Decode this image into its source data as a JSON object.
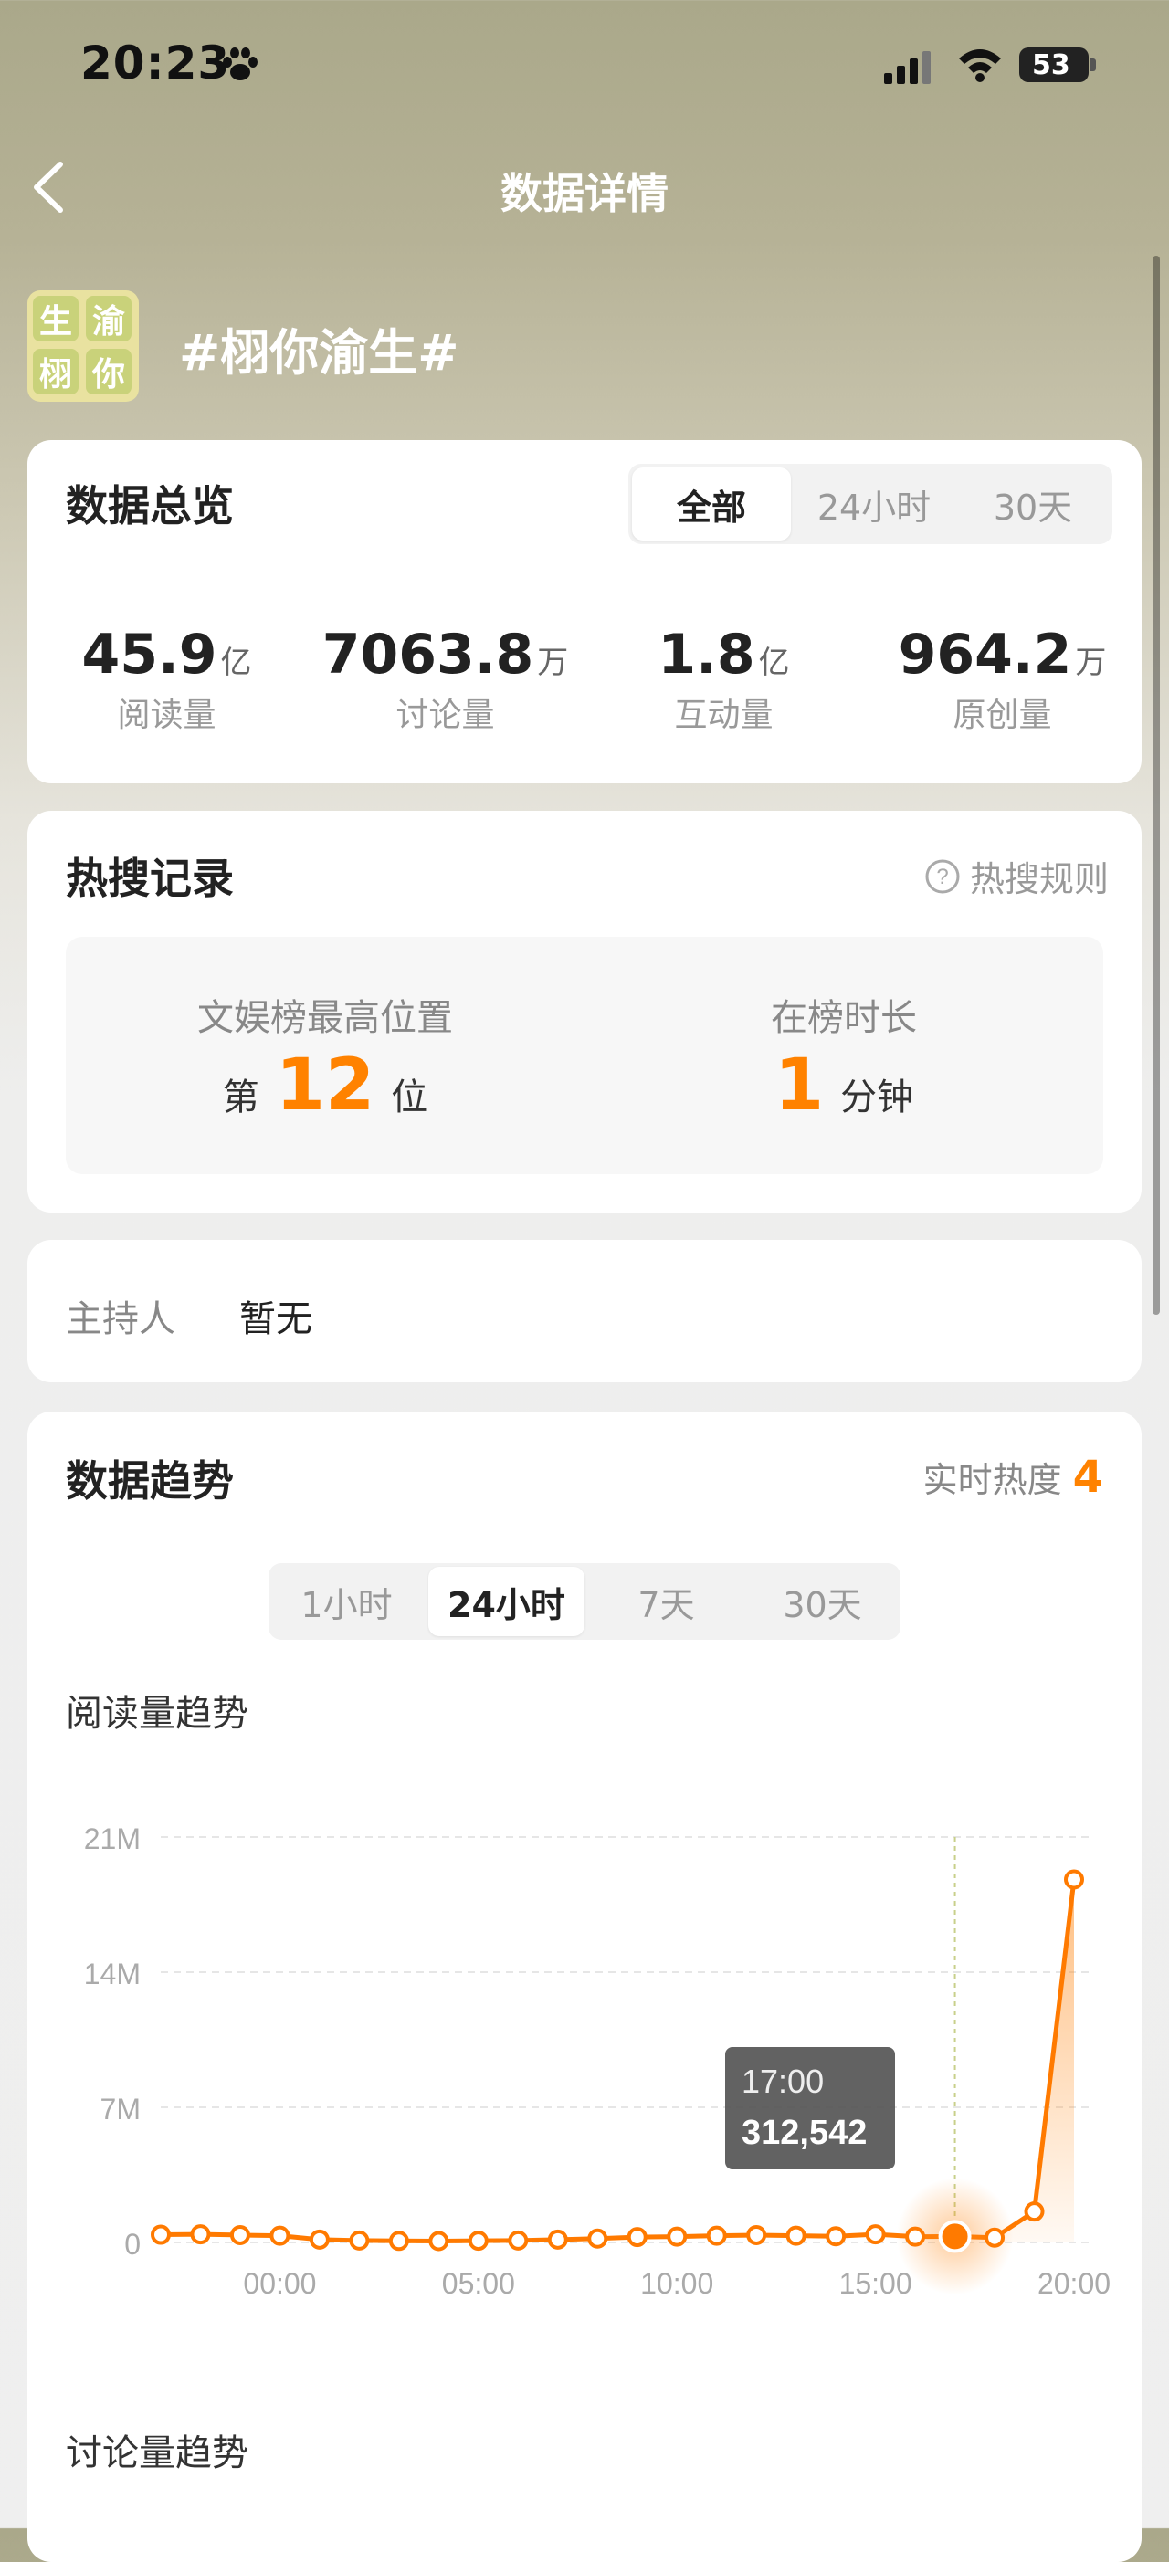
{
  "status_bar": {
    "time": "20:23",
    "battery": "53"
  },
  "nav": {
    "title": "数据详情"
  },
  "topic": {
    "name": "#栩你渝生#",
    "avatar_chars": [
      "生",
      "渝",
      "栩",
      "你"
    ]
  },
  "overview": {
    "title": "数据总览",
    "tabs": [
      {
        "label": "全部",
        "active": true
      },
      {
        "label": "24小时",
        "active": false
      },
      {
        "label": "30天",
        "active": false
      }
    ],
    "stats": [
      {
        "value": "45.9",
        "unit": "亿",
        "label": "阅读量"
      },
      {
        "value": "7063.8",
        "unit": "万",
        "label": "讨论量"
      },
      {
        "value": "1.8",
        "unit": "亿",
        "label": "互动量"
      },
      {
        "value": "964.2",
        "unit": "万",
        "label": "原创量"
      }
    ]
  },
  "hot_search": {
    "title": "热搜记录",
    "rule_label": "热搜规则",
    "best_rank": {
      "label": "文娱榜最高位置",
      "prefix": "第",
      "value": "12",
      "suffix": "位"
    },
    "duration": {
      "label": "在榜时长",
      "value": "1",
      "suffix": "分钟"
    }
  },
  "host": {
    "label": "主持人",
    "value": "暂无"
  },
  "trend": {
    "title": "数据趋势",
    "heat_label": "实时热度",
    "heat_value": "4",
    "tabs": [
      {
        "label": "1小时",
        "active": false
      },
      {
        "label": "24小时",
        "active": true
      },
      {
        "label": "7天",
        "active": false
      },
      {
        "label": "30天",
        "active": false
      }
    ],
    "read_title": "阅读量趋势",
    "discuss_title": "讨论量趋势",
    "tooltip": {
      "time": "17:00",
      "value": "312,542"
    }
  },
  "chart_data": {
    "type": "line",
    "title": "阅读量趋势",
    "xlabel": "",
    "ylabel": "",
    "x_ticks": [
      "00:00",
      "05:00",
      "10:00",
      "15:00",
      "20:00"
    ],
    "y_ticks": [
      "21M",
      "14M",
      "7M",
      "0"
    ],
    "ylim": [
      0,
      21000000
    ],
    "x": [
      "21:00",
      "22:00",
      "23:00",
      "00:00",
      "01:00",
      "02:00",
      "03:00",
      "04:00",
      "05:00",
      "06:00",
      "07:00",
      "08:00",
      "09:00",
      "10:00",
      "11:00",
      "12:00",
      "13:00",
      "14:00",
      "15:00",
      "16:00",
      "17:00",
      "18:00",
      "19:00",
      "20:00"
    ],
    "series": [
      {
        "values": [
          400000,
          420000,
          380000,
          350000,
          150000,
          100000,
          80000,
          70000,
          90000,
          100000,
          150000,
          200000,
          280000,
          300000,
          350000,
          380000,
          350000,
          320000,
          420000,
          300000,
          312542,
          250000,
          1600000,
          18800000
        ]
      }
    ],
    "highlight_index": 20,
    "grid": true,
    "color": "#ff7a00"
  }
}
